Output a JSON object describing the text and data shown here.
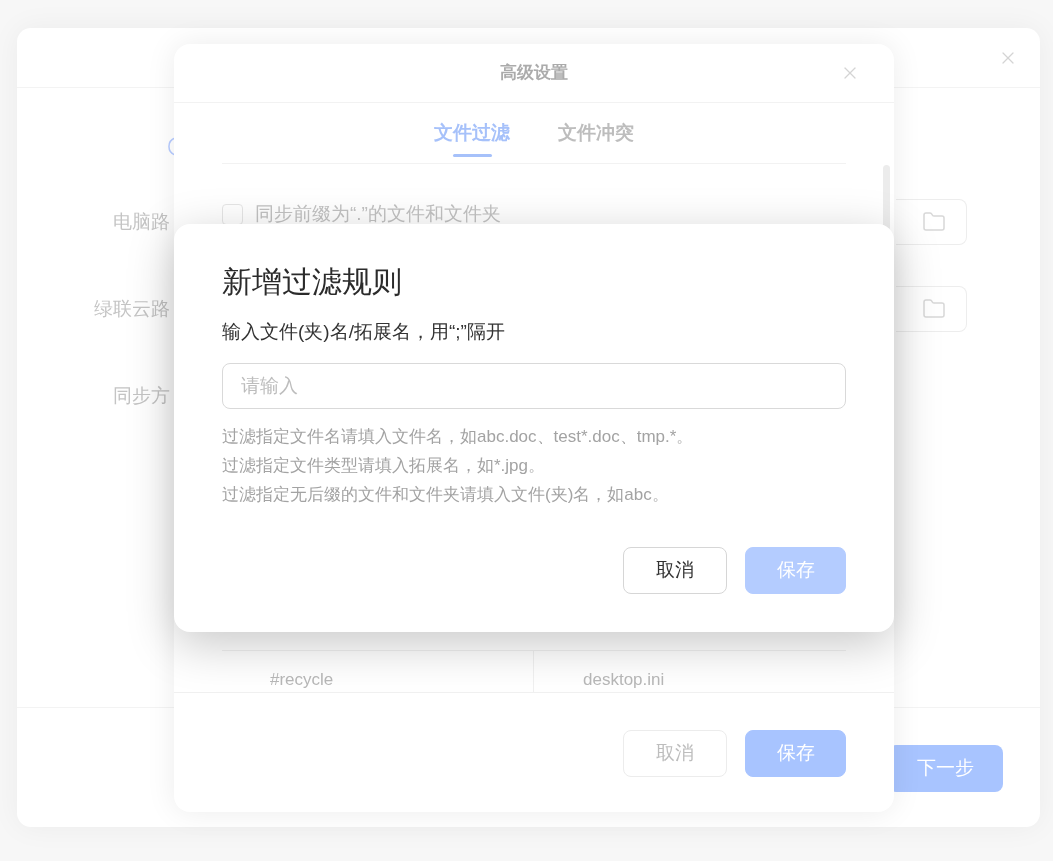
{
  "settings_dialog": {
    "fields": [
      {
        "label": "电脑路",
        "kind": "path"
      },
      {
        "label": "绿联云路",
        "kind": "path"
      },
      {
        "label": "同步方",
        "kind": "option"
      }
    ],
    "next_button": "下一步"
  },
  "advanced_settings": {
    "title": "高级设置",
    "tabs": [
      {
        "label": "文件过滤",
        "selected": true
      },
      {
        "label": "文件冲突",
        "selected": false
      }
    ],
    "checkbox": {
      "label": "同步前缀为“.”的文件和文件夹",
      "checked": false
    },
    "table_rows": [
      {
        "column_1": "#recycle",
        "column_2": "desktop.ini"
      }
    ],
    "buttons": [
      {
        "label": "取消",
        "kind": "secondary"
      },
      {
        "label": "保存",
        "kind": "primary"
      }
    ]
  },
  "add_filter_rule": {
    "title": "新增过滤规则",
    "instruction": "输入文件(夹)名/拓展名，用“;”隔开",
    "input": {
      "placeholder": "请输入"
    },
    "hints": [
      "过滤指定文件名请填入文件名，如abc.doc、test*.doc、tmp.*。",
      "过滤指定文件类型请填入拓展名，如*.jpg。",
      "过滤指定无后缀的文件和文件夹请填入文件(夹)名，如abc。"
    ],
    "buttons": [
      {
        "label": "取消",
        "kind": "secondary",
        "disabled": false
      },
      {
        "label": "保存",
        "kind": "primary",
        "disabled": true
      }
    ]
  }
}
